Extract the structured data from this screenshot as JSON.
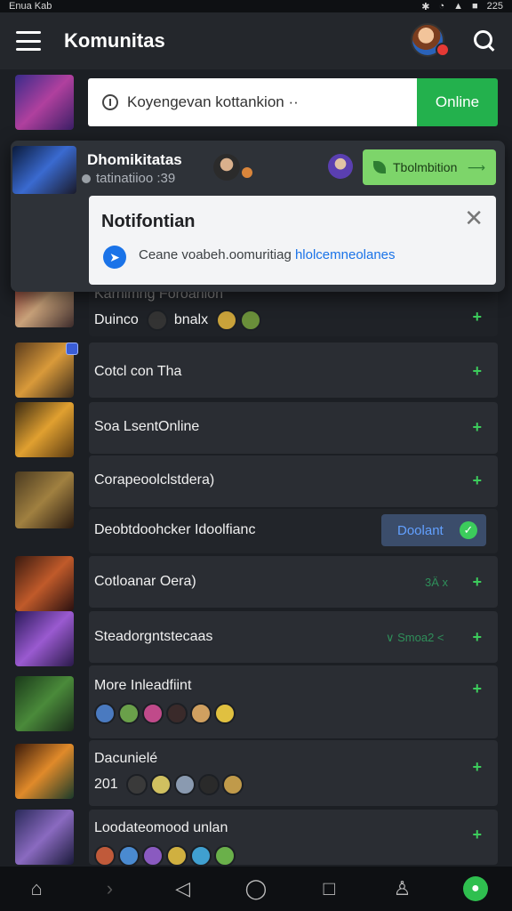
{
  "status": {
    "left": "Enua  Kab",
    "right": "225"
  },
  "header": {
    "title": "Komunitas"
  },
  "search": {
    "placeholder": "Koyengevan kottankion  ··",
    "online_label": "Online"
  },
  "popup": {
    "title": "Dhomikitatas",
    "subtitle": "tatinatiioo  :39",
    "button_label": "Tbolmbition",
    "notification": {
      "title": "Notifontian",
      "text_plain": "Ceane voabeh.oomuritiag ",
      "text_link": "hlolcemneolanes"
    }
  },
  "rows": [
    {
      "label": "Karnimng Foroanlon",
      "second": "Duinco",
      "second_label": "bnalx"
    },
    {
      "label": "Cotcl con Tha"
    },
    {
      "label": "Soa LsentOnline"
    },
    {
      "label": "Corapeoolclstdera)"
    },
    {
      "label": "Deobtdoohcker Idoolfianc",
      "pill": "Doolant"
    },
    {
      "label": "Cotloanar Oera)",
      "hint": "3Ä x"
    },
    {
      "label": "Steadorgntstecaas",
      "hint": "∨ Smoa2 <"
    },
    {
      "label": "More Inleadfiint"
    },
    {
      "label": "Dacunielé",
      "count": "201"
    },
    {
      "label": "Loodateomood unlan"
    }
  ],
  "colors": {
    "accent_green": "#23b14d",
    "background": "#1c1f24",
    "card": "#2a2d33",
    "link_blue": "#1a73e8"
  },
  "icons": [
    "menu-icon",
    "search-icon",
    "info-icon",
    "close-icon",
    "plus-icon",
    "check-icon",
    "home-icon",
    "back-icon",
    "circle-icon",
    "square-icon",
    "person-icon",
    "leaf-icon"
  ]
}
